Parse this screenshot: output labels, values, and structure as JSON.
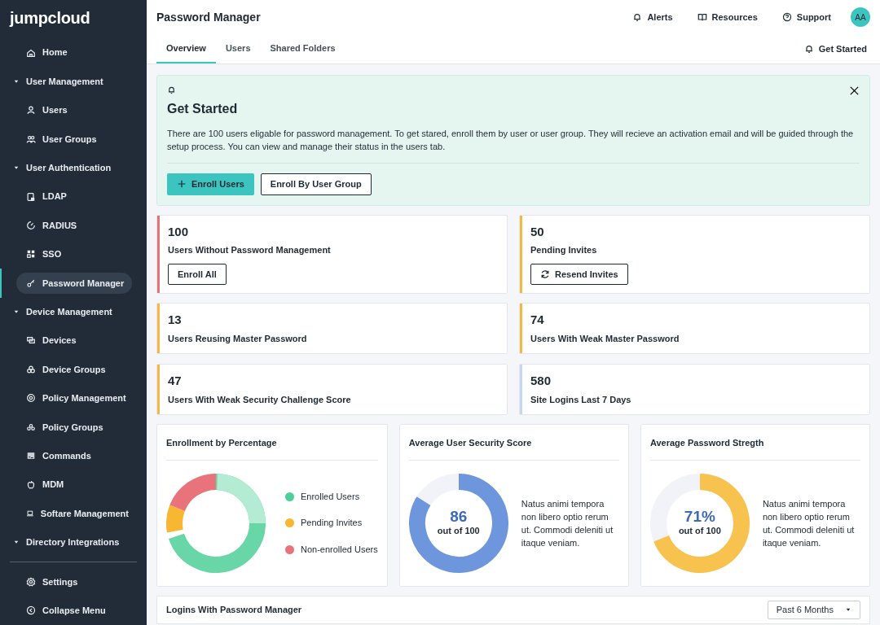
{
  "logo": "jumpcloud",
  "sidebar": {
    "items": [
      {
        "kind": "item",
        "label": "Home",
        "selected": false
      },
      {
        "kind": "section",
        "label": "User Management",
        "expanded": true,
        "children": [
          {
            "kind": "item",
            "label": "Users",
            "selected": false
          },
          {
            "kind": "item",
            "label": "User Groups",
            "selected": false
          }
        ]
      },
      {
        "kind": "section",
        "label": "User Authentication",
        "expanded": true,
        "children": [
          {
            "kind": "item",
            "label": "LDAP",
            "selected": false
          },
          {
            "kind": "item",
            "label": "RADIUS",
            "selected": false
          },
          {
            "kind": "item",
            "label": "SSO",
            "selected": false
          },
          {
            "kind": "item",
            "label": "Password Manager",
            "selected": true
          }
        ]
      },
      {
        "kind": "section",
        "label": "Device Management",
        "expanded": true,
        "children": [
          {
            "kind": "item",
            "label": "Devices",
            "selected": false
          },
          {
            "kind": "item",
            "label": "Device Groups",
            "selected": false
          },
          {
            "kind": "item",
            "label": "Policy Management",
            "selected": false
          },
          {
            "kind": "item",
            "label": "Policy Groups",
            "selected": false
          },
          {
            "kind": "item",
            "label": "Commands",
            "selected": false
          },
          {
            "kind": "item",
            "label": "MDM",
            "selected": false
          },
          {
            "kind": "item",
            "label": "Softare Management",
            "selected": false
          }
        ]
      },
      {
        "kind": "section",
        "label": "Directory Integrations",
        "expanded": true
      }
    ],
    "footer": [
      "Settings",
      "Collapse Menu"
    ]
  },
  "header": {
    "title": "Password Manager",
    "links": [
      "Alerts",
      "Resources",
      "Support"
    ],
    "avatar": "AA"
  },
  "tabs": [
    {
      "label": "Overview",
      "selected": true
    },
    {
      "label": "Users",
      "selected": false
    },
    {
      "label": "Shared Folders",
      "selected": false
    }
  ],
  "get_started_link": "Get Started",
  "banner": {
    "title": "Get Started",
    "text": "There are 100 users eligable for password management.  To get stared, enroll them by user or user group. They will recieve an activation email and will be guided through the setup process. You can view and manage their status in the users tab.",
    "primary_button": "Enroll Users",
    "secondary_button": "Enroll By User Group"
  },
  "stats": [
    {
      "value": "100",
      "label": "Users Without Password Management",
      "color": "#e57373",
      "button": "Enroll All"
    },
    {
      "value": "50",
      "label": "Pending Invites",
      "color": "#f5b942",
      "button": "Resend Invites"
    },
    {
      "value": "13",
      "label": "Users Reusing Master Password",
      "color": "#f5b942"
    },
    {
      "value": "74",
      "label": "Users With Weak Master Password",
      "color": "#f5b942"
    },
    {
      "value": "47",
      "label": "Users With Weak Security Challenge Score",
      "color": "#f5b942"
    },
    {
      "value": "580",
      "label": "Site Logins Last 7 Days",
      "color": "#c9d6f0"
    }
  ],
  "enrollment": {
    "title": "Enrollment by Percentage",
    "legend": [
      {
        "label": "Enrolled Users",
        "color": "#4fcf98"
      },
      {
        "label": "Pending Invites",
        "color": "#f7b733"
      },
      {
        "label": "Non-enrolled Users",
        "color": "#e8737a"
      }
    ]
  },
  "gauges": [
    {
      "title": "Average User Security Score",
      "value": "86",
      "sub": "out of 100",
      "color": "#6e96dc",
      "text": "Natus animi tempora non libero optio rerum ut. Commodi deleniti ut itaque veniam."
    },
    {
      "title": "Average Password Stregth",
      "value": "71%",
      "sub": "out of 100",
      "color": "#f8c24e",
      "text": "Natus animi tempora non libero optio rerum ut. Commodi deleniti ut itaque veniam."
    }
  ],
  "logins": {
    "title": "Logins With Password Manager",
    "range": "Past 6 Months"
  }
}
